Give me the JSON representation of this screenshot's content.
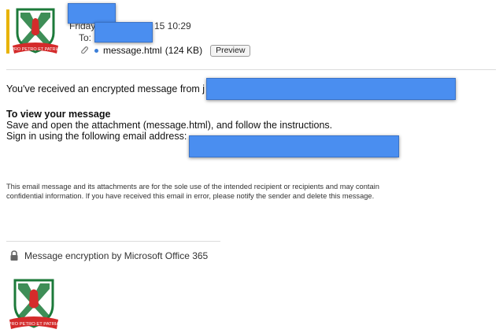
{
  "header": {
    "date_text": "Friday",
    "time_text": "15 10:29",
    "to_label": "To:",
    "attachment_name": "message.html",
    "attachment_size": "(124 KB)",
    "preview_label": "Preview",
    "accent_color": "#e8b300"
  },
  "body": {
    "intro": "You've received an encrypted message from j",
    "heading": "To view your message",
    "line1": "Save and open the attachment (message.html), and follow the instructions.",
    "line2": "Sign in using the following email address: "
  },
  "disclaimer": {
    "line1": "This email message and its attachments are for the sole use of the intended recipient or recipients and may contain",
    "line2": "confidential information. If you have received this email in error, please notify the sender and delete this message."
  },
  "footer": {
    "encryption_text": "Message encryption by Microsoft Office 365",
    "motto": "PRO PETRO ET PATRIA"
  },
  "icons": {
    "lock": "lock-icon",
    "paperclip": "paperclip-icon",
    "crest": "school-crest-icon"
  },
  "colors": {
    "redaction": "#4a8ef0",
    "crest_red": "#d42b2b",
    "crest_green": "#1c7a3a"
  }
}
